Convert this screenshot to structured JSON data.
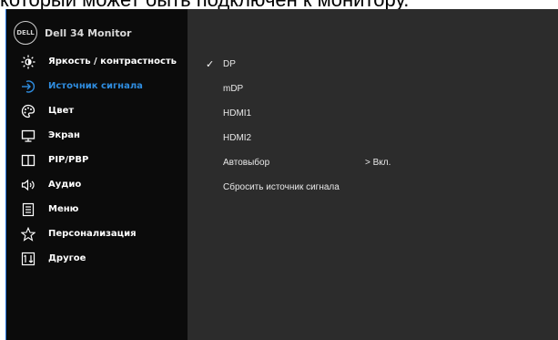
{
  "page_header_text": "который может быть подключен к монитору.",
  "brand": {
    "logo_text": "DELL",
    "model": "Dell 34 Monitor"
  },
  "menu": {
    "items": [
      {
        "label": "Яркость / контрастность",
        "icon": "brightness-icon",
        "active": false
      },
      {
        "label": "Источник сигнала",
        "icon": "input-source-icon",
        "active": true
      },
      {
        "label": "Цвет",
        "icon": "palette-icon",
        "active": false
      },
      {
        "label": "Экран",
        "icon": "display-icon",
        "active": false
      },
      {
        "label": "PIP/PBP",
        "icon": "pip-icon",
        "active": false
      },
      {
        "label": "Аудио",
        "icon": "speaker-icon",
        "active": false
      },
      {
        "label": "Меню",
        "icon": "menu-icon",
        "active": false
      },
      {
        "label": "Персонализация",
        "icon": "star-icon",
        "active": false
      },
      {
        "label": "Другое",
        "icon": "other-icon",
        "active": false
      }
    ]
  },
  "options": {
    "items": [
      {
        "label": "DP",
        "checked": true,
        "value": ""
      },
      {
        "label": "mDP",
        "checked": false,
        "value": ""
      },
      {
        "label": "HDMI1",
        "checked": false,
        "value": ""
      },
      {
        "label": "HDMI2",
        "checked": false,
        "value": ""
      },
      {
        "label": "Автовыбор",
        "checked": false,
        "value": "> Вкл."
      },
      {
        "label": "Сбросить  источник сигнала",
        "checked": false,
        "value": ""
      }
    ],
    "check_glyph": "✓"
  },
  "colors": {
    "accent": "#2f8de0",
    "sidebar_bg": "#0b0b0b",
    "panel_bg": "#2c2c2c",
    "text": "#ffffff"
  }
}
